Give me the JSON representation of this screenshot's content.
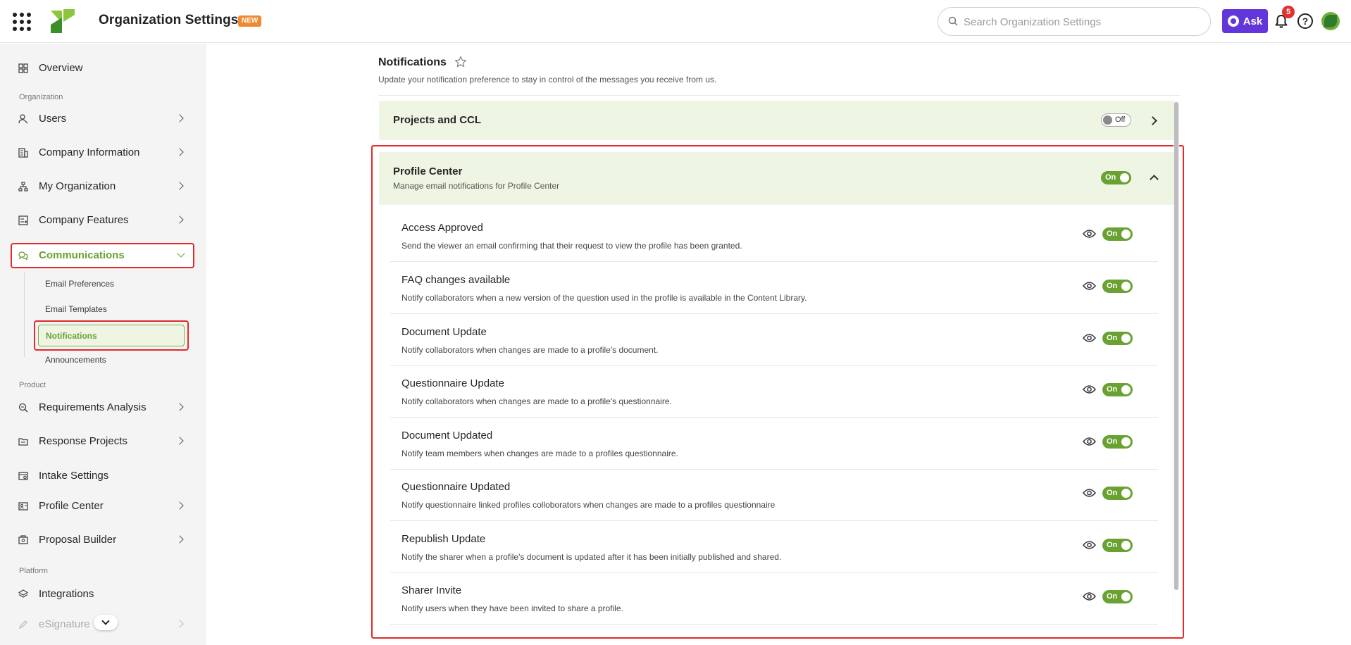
{
  "header": {
    "title": "Organization Settings",
    "badge": "NEW",
    "search_placeholder": "Search Organization Settings",
    "ask_label": "Ask",
    "notification_count": "5",
    "help_label": "?"
  },
  "sidebar": {
    "overview": "Overview",
    "sections": {
      "organization": "Organization",
      "product": "Product",
      "platform": "Platform"
    },
    "items": {
      "users": "Users",
      "company_information": "Company Information",
      "my_organization": "My Organization",
      "company_features": "Company Features",
      "communications": "Communications",
      "requirements_analysis": "Requirements Analysis",
      "response_projects": "Response Projects",
      "intake_settings": "Intake Settings",
      "profile_center": "Profile Center",
      "proposal_builder": "Proposal Builder",
      "integrations": "Integrations",
      "esignature": "eSignature"
    },
    "sub_items": {
      "email_preferences": "Email Preferences",
      "email_templates": "Email Templates",
      "notifications": "Notifications",
      "announcements": "Announcements"
    }
  },
  "main": {
    "title": "Notifications",
    "subtitle": "Update your notification preference to stay in control of the messages you receive from us.",
    "panels": {
      "projects": {
        "title": "Projects and CCL",
        "toggle": "Off"
      },
      "profile_center": {
        "title": "Profile Center",
        "description": "Manage email notifications for Profile Center",
        "toggle": "On",
        "rows": [
          {
            "title": "Access Approved",
            "description": "Send the viewer an email confirming that their request to view the profile has been granted.",
            "toggle": "On"
          },
          {
            "title": "FAQ changes available",
            "description": "Notify collaborators when a new version of the question used in the profile is available in the Content Library.",
            "toggle": "On"
          },
          {
            "title": "Document Update",
            "description": "Notify collaborators when changes are made to a profile's document.",
            "toggle": "On"
          },
          {
            "title": "Questionnaire Update",
            "description": "Notify collaborators when changes are made to a profile's questionnaire.",
            "toggle": "On"
          },
          {
            "title": "Document Updated",
            "description": "Notify team members when changes are made to a profiles questionnaire.",
            "toggle": "On"
          },
          {
            "title": "Questionnaire Updated",
            "description": "Notify questionnaire linked profiles colloborators when changes are made to a profiles questionnaire",
            "toggle": "On"
          },
          {
            "title": "Republish Update",
            "description": "Notify the sharer when a profile's document is updated after it has been initially published and shared.",
            "toggle": "On"
          },
          {
            "title": "Sharer Invite",
            "description": "Notify users when they have been invited to share a profile.",
            "toggle": "On"
          }
        ]
      }
    }
  },
  "colors": {
    "accent_green": "#6aa232",
    "panel_bg": "#eef5e3",
    "highlight_red": "#e22b2b",
    "ask_purple": "#6236d9"
  }
}
